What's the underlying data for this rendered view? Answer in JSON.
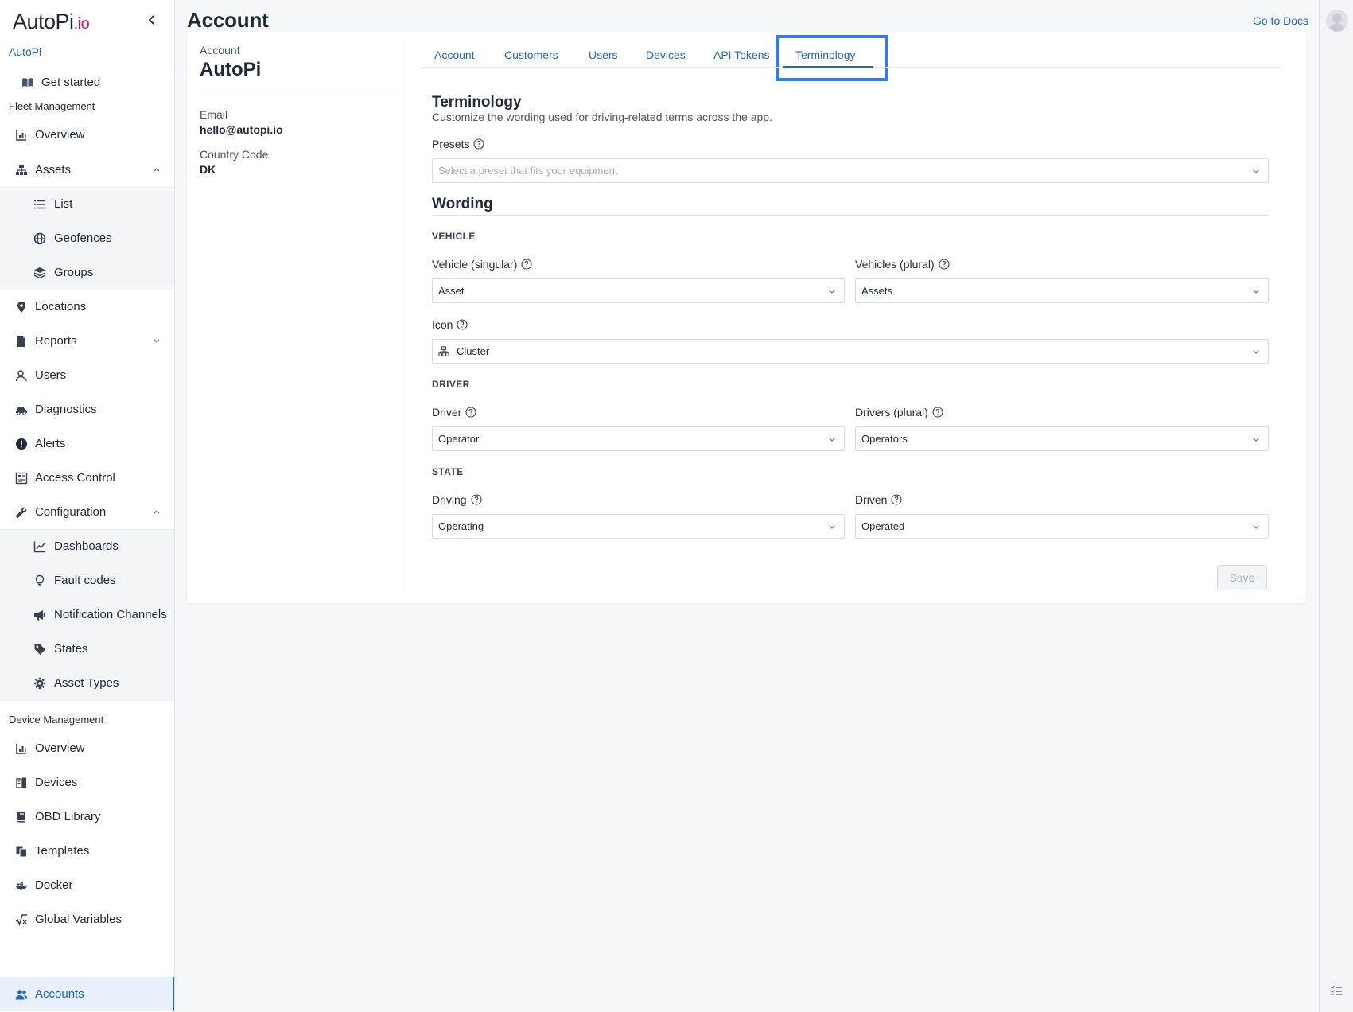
{
  "app": {
    "logo_text": "AutoPi",
    "logo_suffix": ".io",
    "org_name": "AutoPi"
  },
  "sidebar": {
    "get_started": "Get started",
    "fleet_section": "Fleet Management",
    "fleet_items": [
      {
        "label": "Overview",
        "icon": "chart-icon"
      },
      {
        "label": "Assets",
        "icon": "cluster-icon",
        "expanded": true
      },
      {
        "label": "List",
        "icon": "list-icon"
      },
      {
        "label": "Geofences",
        "icon": "globe-icon"
      },
      {
        "label": "Groups",
        "icon": "layers-icon"
      },
      {
        "label": "Locations",
        "icon": "pin-icon"
      },
      {
        "label": "Reports",
        "icon": "file-icon",
        "expanded": false
      },
      {
        "label": "Users",
        "icon": "user-icon"
      },
      {
        "label": "Diagnostics",
        "icon": "car-icon"
      },
      {
        "label": "Alerts",
        "icon": "alert-icon"
      },
      {
        "label": "Access Control",
        "icon": "access-icon"
      },
      {
        "label": "Configuration",
        "icon": "wrench-icon",
        "expanded": true
      },
      {
        "label": "Dashboards",
        "icon": "line-chart-icon"
      },
      {
        "label": "Fault codes",
        "icon": "bulb-icon"
      },
      {
        "label": "Notification Channels",
        "icon": "megaphone-icon"
      },
      {
        "label": "States",
        "icon": "tag-icon"
      },
      {
        "label": "Asset Types",
        "icon": "gear-icon"
      }
    ],
    "device_section": "Device Management",
    "device_items": [
      {
        "label": "Overview",
        "icon": "chart-icon"
      },
      {
        "label": "Devices",
        "icon": "devices-icon"
      },
      {
        "label": "OBD Library",
        "icon": "book-icon"
      },
      {
        "label": "Templates",
        "icon": "templates-icon"
      },
      {
        "label": "Docker",
        "icon": "docker-icon"
      },
      {
        "label": "Global Variables",
        "icon": "variable-icon"
      }
    ],
    "accounts": "Accounts"
  },
  "header": {
    "title": "Account",
    "docs_link": "Go to Docs"
  },
  "account": {
    "label": "Account",
    "name": "AutoPi",
    "email_label": "Email",
    "email": "hello@autopi.io",
    "country_label": "Country Code",
    "country": "DK"
  },
  "tabs": [
    {
      "label": "Account"
    },
    {
      "label": "Customers"
    },
    {
      "label": "Users"
    },
    {
      "label": "Devices"
    },
    {
      "label": "API Tokens"
    },
    {
      "label": "Terminology",
      "active": true
    }
  ],
  "terminology": {
    "title": "Terminology",
    "description": "Customize the wording used for driving-related terms across the app.",
    "presets_label": "Presets",
    "presets_placeholder": "Select a preset that fits your equipment",
    "wording_title": "Wording",
    "vehicle_group": "VEHICLE",
    "vehicle_singular_label": "Vehicle (singular)",
    "vehicle_singular_value": "Asset",
    "vehicle_plural_label": "Vehicles (plural)",
    "vehicle_plural_value": "Assets",
    "icon_label": "Icon",
    "icon_value": "Cluster",
    "driver_group": "DRIVER",
    "driver_label": "Driver",
    "driver_value": "Operator",
    "drivers_plural_label": "Drivers (plural)",
    "drivers_plural_value": "Operators",
    "state_group": "STATE",
    "driving_label": "Driving",
    "driving_value": "Operating",
    "driven_label": "Driven",
    "driven_value": "Operated",
    "save_label": "Save"
  },
  "colors": {
    "accent": "#1f66c9",
    "highlight_box": "#2f7cf6",
    "logo_io": "#d4145a"
  }
}
